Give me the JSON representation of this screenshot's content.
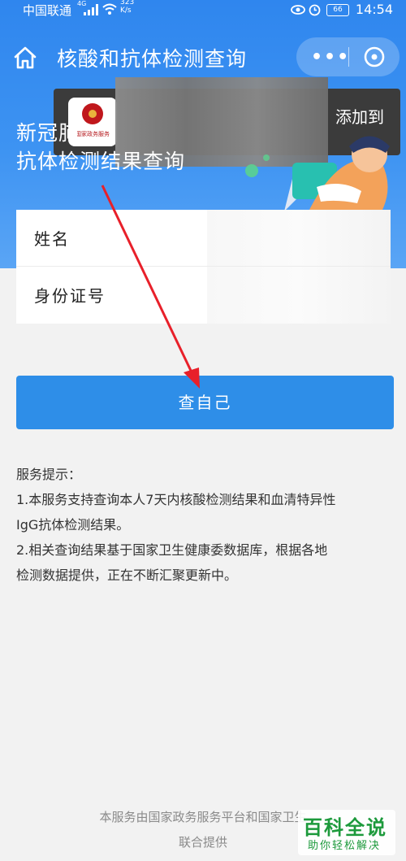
{
  "status_bar": {
    "carrier": "中国联通",
    "net_type": "4G",
    "net_speed_value": "323",
    "net_speed_unit": "K/s",
    "battery": "66",
    "time": "14:54"
  },
  "titlebar": {
    "title": "核酸和抗体检测查询",
    "more_label": "•••"
  },
  "popup": {
    "logo_text": "国家政务服务",
    "add_label": "添加到"
  },
  "hero": {
    "line1": "新冠肺",
    "line2": "抗体检测结果查询"
  },
  "form": {
    "name_label": "姓名",
    "id_label": "身份证号"
  },
  "query_button": "查自己",
  "tips": {
    "heading": "服务提示：",
    "line1": "1.本服务支持查询本人7天内核酸检测结果和血清特异性",
    "line2": "IgG抗体检测结果。",
    "line3": "2.相关查询结果基于国家卫生健康委数据库，根据各地",
    "line4": "检测数据提供，正在不断汇聚更新中。"
  },
  "footer": {
    "line1": "本服务由国家政务服务平台和国家卫生",
    "line2": "联合提供"
  },
  "watermark": {
    "title": "百科全说",
    "subtitle": "助你轻松解决"
  },
  "colors": {
    "header_blue": "#2f86ee",
    "button_blue": "#2e8ee8",
    "arrow_red": "#e8202a",
    "watermark_green": "#1d9a3c"
  }
}
